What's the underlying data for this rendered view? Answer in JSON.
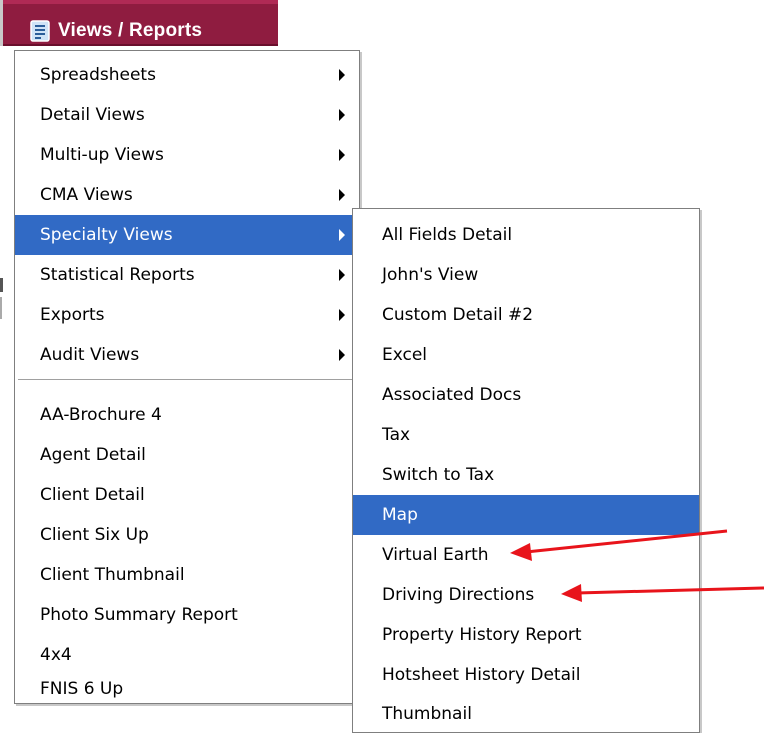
{
  "header": {
    "title": "Views / Reports",
    "icon": "document-icon",
    "bar_color": "#8f1c40"
  },
  "main_menu": {
    "submenu_items": [
      "Spreadsheets",
      "Detail Views",
      "Multi-up Views",
      "CMA Views",
      "Specialty Views",
      "Statistical Reports",
      "Exports",
      "Audit Views"
    ],
    "highlighted": "Specialty Views",
    "report_items": [
      "AA-Brochure 4",
      "Agent Detail",
      "Client Detail",
      "Client Six Up",
      "Client Thumbnail",
      "Photo Summary Report",
      "4x4",
      "FNIS 6 Up"
    ]
  },
  "sub_menu": {
    "items": [
      "All Fields Detail",
      "John's View",
      "Custom Detail #2",
      "Excel",
      "Associated Docs",
      "Tax",
      "Switch to Tax",
      "Map",
      "Virtual Earth",
      "Driving Directions",
      "Property History Report",
      "Hotsheet History Detail",
      "Thumbnail"
    ],
    "highlighted": "Map"
  },
  "annotations": {
    "arrow_color": "#e8141b",
    "pointing_to": [
      "Virtual Earth",
      "Driving Directions"
    ]
  },
  "colors": {
    "highlight": "#316ac5",
    "menu_border": "#7f7f7f"
  }
}
